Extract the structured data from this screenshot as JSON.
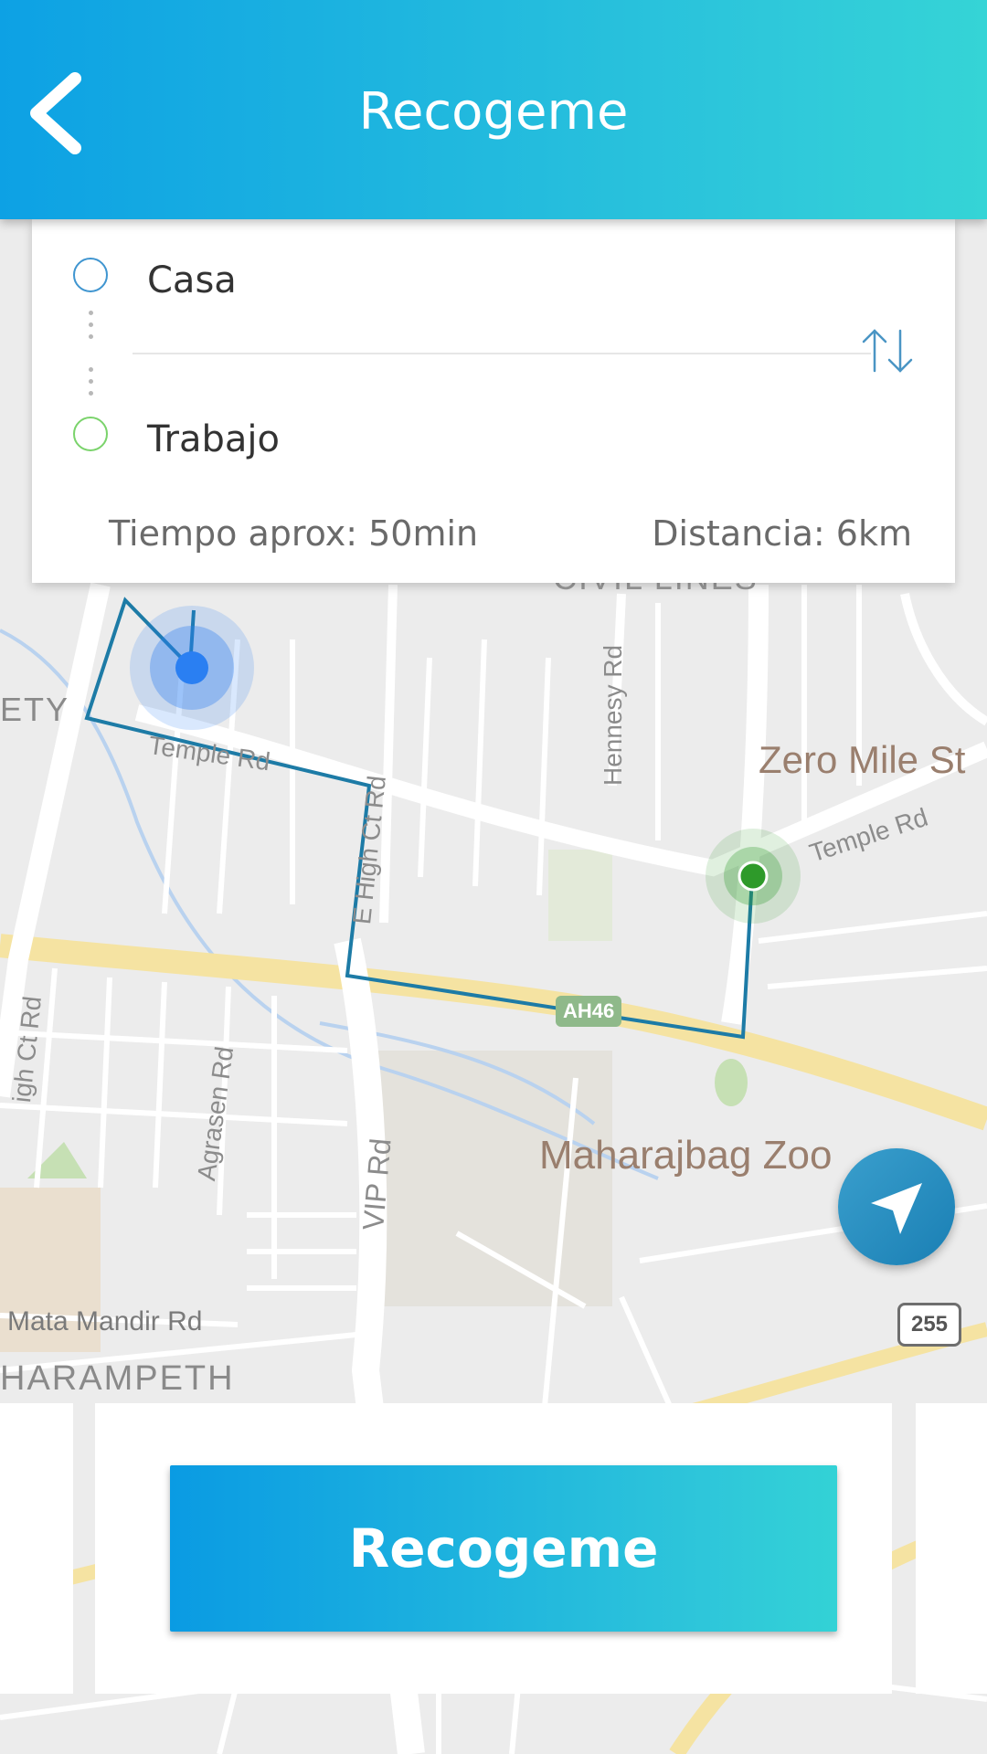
{
  "header": {
    "title": "Recogeme",
    "back_icon": "chevron-left-icon"
  },
  "route": {
    "origin": "Casa",
    "destination": "Trabajo",
    "time": "Tiempo aprox: 50min",
    "distance": "Distancia: 6km",
    "swap_icon": "swap-vertical-icon"
  },
  "map": {
    "labels": {
      "temple_rd_1": "Temple Rd",
      "temple_rd_2": "Temple Rd",
      "hennesy_rd": "Hennesy Rd",
      "e_high_ct_rd": "E High Ct Rd",
      "agrasen_rd": "Agrasen Rd",
      "vip_rd": "VIP Rd",
      "high_ct_rd": "igh Ct Rd",
      "zero_mile": "Zero Mile St",
      "zoo": "Maharajbag Zoo",
      "mata_mandir": "Mata Mandir Rd",
      "harampeth": "HARAMPETH",
      "ety": "ETY",
      "civil_lines": "CIVIL LINES"
    },
    "shields": {
      "ah": "AH46",
      "state": "255"
    },
    "colors": {
      "route": "#1d7ba6",
      "origin_marker": "#2a7ff2",
      "destination_marker": "#2e9a2a",
      "highway": "#f6e6a6"
    }
  },
  "locate_button": {
    "icon": "navigation-arrow-icon"
  },
  "cta": {
    "label": "Recogeme"
  },
  "theme": {
    "gradient_start": "#0da1e4",
    "gradient_end": "#35d4d6"
  }
}
